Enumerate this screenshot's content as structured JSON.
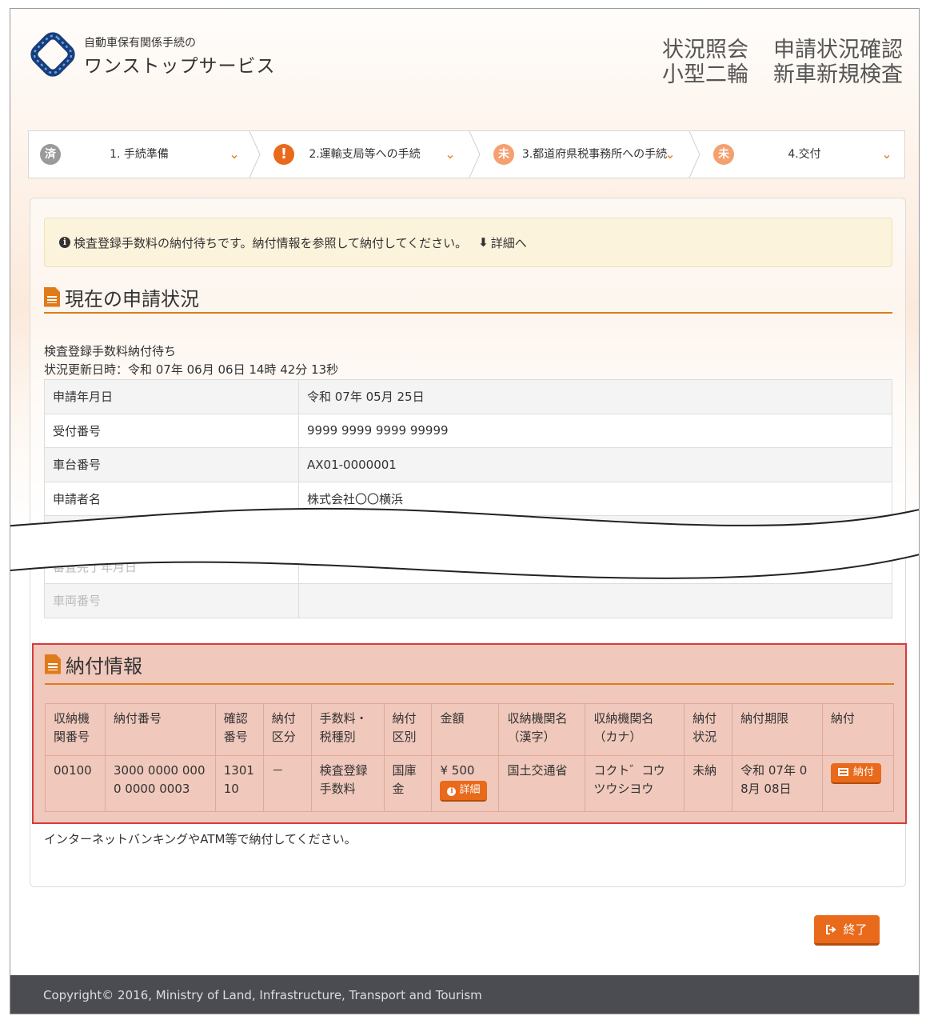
{
  "header": {
    "logo_sub": "自動車保有関係手続の",
    "logo_main": "ワンストップサービス",
    "title_left_1": "状況照会",
    "title_left_2": "小型二輪",
    "title_right_1": "申請状況確認",
    "title_right_2": "新車新規検査"
  },
  "steps": [
    {
      "badge": "済",
      "label": "1. 手続準備",
      "badge_color": "#9a9a9a"
    },
    {
      "badge": "!",
      "label": "2.運輸支局等への手続",
      "badge_color": "#e86a1a"
    },
    {
      "badge": "未",
      "label": "3.都道府県税事務所への手続",
      "badge_color": "#f4a070"
    },
    {
      "badge": "未",
      "label": "4.交付",
      "badge_color": "#f4a070"
    }
  ],
  "alert": {
    "text": "検査登録手数料の納付待ちです。納付情報を参照して納付してください。",
    "link": "詳細へ"
  },
  "status_section": {
    "title": "現在の申請状況",
    "status": "検査登録手数料納付待ち",
    "updated": "状況更新日時：令和 07年 06月 06日 14時 42分 13秒",
    "rows": [
      {
        "label": "申請年月日",
        "value": "令和 07年 05月 25日"
      },
      {
        "label": "受付番号",
        "value": "9999 9999 9999 99999"
      },
      {
        "label": "車台番号",
        "value": "AX01-0000001"
      },
      {
        "label": "申請者名",
        "value": "株式会社〇〇横浜"
      },
      {
        "label": "",
        "value": ""
      },
      {
        "label": "審査完了年月日",
        "value": ""
      },
      {
        "label": "車両番号",
        "value": ""
      }
    ]
  },
  "payment_section": {
    "title": "納付情報",
    "headers": [
      "収納機関番号",
      "納付番号",
      "確認番号",
      "納付区分",
      "手数料・税種別",
      "納付区別",
      "金額",
      "収納機関名（漢字）",
      "収納機関名（カナ）",
      "納付状況",
      "納付期限",
      "納付"
    ],
    "row": {
      "org_no": "00100",
      "pay_no": "3000 0000 0000 0000 0003",
      "confirm_no": "130110",
      "pay_div": "－",
      "fee_type": "検査登録手数料",
      "pay_class": "国庫金",
      "amount": "¥ 500",
      "detail_btn": "詳細",
      "org_kanji": "国土交通省",
      "org_kana": "コクト゛コウツウシヨウ",
      "status": "未納",
      "deadline": "令和 07年 08月 08日",
      "pay_btn": "納付"
    },
    "note": "インターネットバンキングやATM等で納付してください。"
  },
  "end_button": "終了",
  "footer": "Copyright© 2016, Ministry of Land, Infrastructure, Transport and Tourism"
}
